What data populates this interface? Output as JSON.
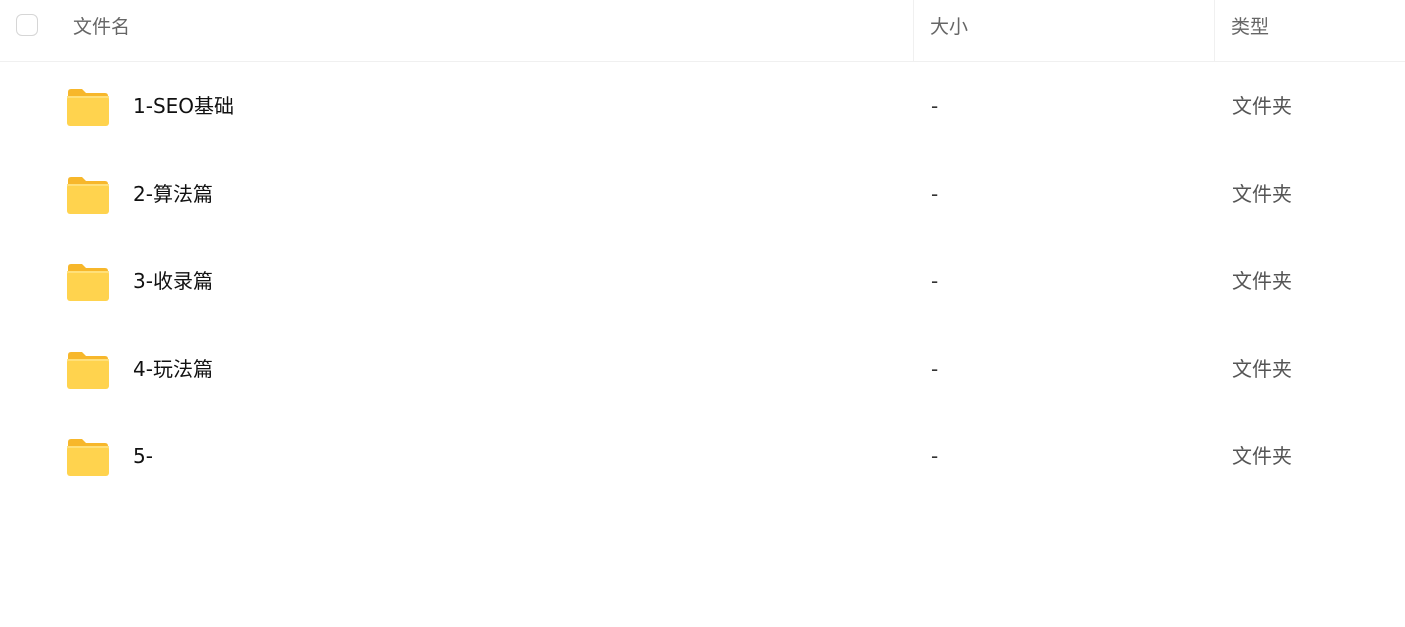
{
  "header": {
    "name_label": "文件名",
    "size_label": "大小",
    "type_label": "类型"
  },
  "colors": {
    "folder_back": "#f7b72b",
    "folder_front": "#ffd34e"
  },
  "files": [
    {
      "name": "1-SEO基础",
      "size": "-",
      "type": "文件夹",
      "icon": "folder-icon"
    },
    {
      "name": "2-算法篇",
      "size": "-",
      "type": "文件夹",
      "icon": "folder-icon"
    },
    {
      "name": "3-收录篇",
      "size": "-",
      "type": "文件夹",
      "icon": "folder-icon"
    },
    {
      "name": "4-玩法篇",
      "size": "-",
      "type": "文件夹",
      "icon": "folder-icon"
    },
    {
      "name": "5-",
      "size": "-",
      "type": "文件夹",
      "icon": "folder-icon"
    }
  ]
}
